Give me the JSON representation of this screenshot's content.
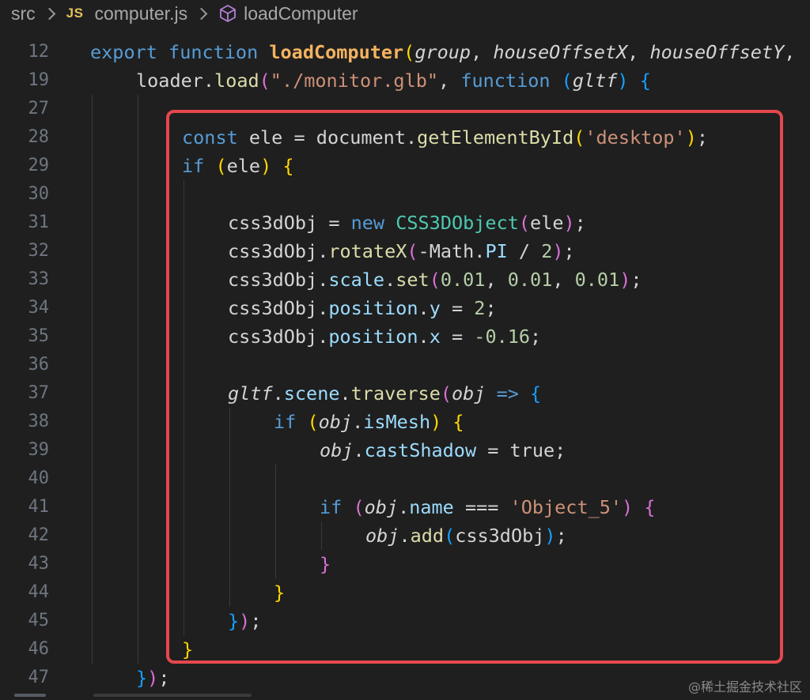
{
  "breadcrumb": {
    "folder": "src",
    "file_badge": "JS",
    "file": "computer.js",
    "symbol": "loadComputer"
  },
  "colors": {
    "keyword": "#569cd6",
    "control": "#c586c0",
    "function": "#dcdcaa",
    "funcdef": "#f4b35f",
    "variable": "#d4d4d4",
    "property": "#9cdcfe",
    "string": "#ce9178",
    "number": "#b5cea8",
    "class": "#4ec9b0",
    "bracket1": "#ffd700",
    "bracket2": "#da70d6",
    "bracket3": "#179fff",
    "highlight": "#e5484d"
  },
  "lines": [
    {
      "n": "12",
      "indent": 0,
      "tokens": [
        [
          "export ",
          "kw"
        ],
        [
          "function ",
          "kw"
        ],
        [
          "loadComputer",
          "fd"
        ],
        [
          "(",
          "b1"
        ],
        [
          "group",
          "pi"
        ],
        [
          ", ",
          "pl"
        ],
        [
          "houseOffsetX",
          "pi"
        ],
        [
          ", ",
          "pl"
        ],
        [
          "houseOffsetY",
          "pi"
        ],
        [
          ",",
          "pl"
        ]
      ]
    },
    {
      "n": "19",
      "indent": 1,
      "tokens": [
        [
          "loader",
          "pl"
        ],
        [
          ".",
          "pl"
        ],
        [
          "load",
          "fn"
        ],
        [
          "(",
          "b2"
        ],
        [
          "\"./monitor.glb\"",
          "st"
        ],
        [
          ", ",
          "pl"
        ],
        [
          "function ",
          "kw"
        ],
        [
          "(",
          "b3"
        ],
        [
          "gltf",
          "pi"
        ],
        [
          ") ",
          "b3"
        ],
        [
          "{",
          "b3"
        ]
      ]
    },
    {
      "n": "27",
      "indent": 0,
      "tokens": []
    },
    {
      "n": "28",
      "indent": 2,
      "tokens": [
        [
          "const ",
          "kw"
        ],
        [
          "ele",
          "pl"
        ],
        [
          " = ",
          "pl"
        ],
        [
          "document",
          "pl"
        ],
        [
          ".",
          "pl"
        ],
        [
          "getElementById",
          "fn"
        ],
        [
          "(",
          "b1"
        ],
        [
          "'desktop'",
          "st"
        ],
        [
          ")",
          "b1"
        ],
        [
          ";",
          "pl"
        ]
      ]
    },
    {
      "n": "29",
      "indent": 2,
      "tokens": [
        [
          "if ",
          "ctl"
        ],
        [
          "(",
          "b1"
        ],
        [
          "ele",
          "pl"
        ],
        [
          ") ",
          "b1"
        ],
        [
          "{",
          "b1"
        ]
      ]
    },
    {
      "n": "30",
      "indent": 0,
      "tokens": []
    },
    {
      "n": "31",
      "indent": 3,
      "tokens": [
        [
          "css3dObj",
          "pl"
        ],
        [
          " = ",
          "pl"
        ],
        [
          "new ",
          "kw"
        ],
        [
          "CSS3DObject",
          "cl"
        ],
        [
          "(",
          "b2"
        ],
        [
          "ele",
          "pl"
        ],
        [
          ")",
          "b2"
        ],
        [
          ";",
          "pl"
        ]
      ]
    },
    {
      "n": "32",
      "indent": 3,
      "tokens": [
        [
          "css3dObj",
          "pl"
        ],
        [
          ".",
          "pl"
        ],
        [
          "rotateX",
          "fn"
        ],
        [
          "(",
          "b2"
        ],
        [
          "-Math",
          "pl"
        ],
        [
          ".",
          "pl"
        ],
        [
          "PI",
          "cst"
        ],
        [
          " / ",
          "pl"
        ],
        [
          "2",
          "nm"
        ],
        [
          ")",
          "b2"
        ],
        [
          ";",
          "pl"
        ]
      ]
    },
    {
      "n": "33",
      "indent": 3,
      "tokens": [
        [
          "css3dObj",
          "pl"
        ],
        [
          ".",
          "pl"
        ],
        [
          "scale",
          "pr"
        ],
        [
          ".",
          "pl"
        ],
        [
          "set",
          "fn"
        ],
        [
          "(",
          "b2"
        ],
        [
          "0.01",
          "nm"
        ],
        [
          ", ",
          "pl"
        ],
        [
          "0.01",
          "nm"
        ],
        [
          ", ",
          "pl"
        ],
        [
          "0.01",
          "nm"
        ],
        [
          ")",
          "b2"
        ],
        [
          ";",
          "pl"
        ]
      ]
    },
    {
      "n": "34",
      "indent": 3,
      "tokens": [
        [
          "css3dObj",
          "pl"
        ],
        [
          ".",
          "pl"
        ],
        [
          "position",
          "pr"
        ],
        [
          ".",
          "pl"
        ],
        [
          "y",
          "pr"
        ],
        [
          " = ",
          "pl"
        ],
        [
          "2",
          "nm"
        ],
        [
          ";",
          "pl"
        ]
      ]
    },
    {
      "n": "35",
      "indent": 3,
      "tokens": [
        [
          "css3dObj",
          "pl"
        ],
        [
          ".",
          "pl"
        ],
        [
          "position",
          "pr"
        ],
        [
          ".",
          "pl"
        ],
        [
          "x",
          "pr"
        ],
        [
          " = ",
          "pl"
        ],
        [
          "-0.16",
          "nm"
        ],
        [
          ";",
          "pl"
        ]
      ]
    },
    {
      "n": "36",
      "indent": 0,
      "tokens": []
    },
    {
      "n": "37",
      "indent": 3,
      "tokens": [
        [
          "gltf",
          "pi"
        ],
        [
          ".",
          "pl"
        ],
        [
          "scene",
          "pr"
        ],
        [
          ".",
          "pl"
        ],
        [
          "traverse",
          "fn"
        ],
        [
          "(",
          "b2"
        ],
        [
          "obj",
          "pi"
        ],
        [
          " => ",
          "kw"
        ],
        [
          "{",
          "b3"
        ]
      ]
    },
    {
      "n": "38",
      "indent": 4,
      "tokens": [
        [
          "if ",
          "ctl"
        ],
        [
          "(",
          "b1"
        ],
        [
          "obj",
          "pi"
        ],
        [
          ".",
          "pl"
        ],
        [
          "isMesh",
          "pr"
        ],
        [
          ") ",
          "b1"
        ],
        [
          "{",
          "b1"
        ]
      ]
    },
    {
      "n": "39",
      "indent": 5,
      "tokens": [
        [
          "obj",
          "pi"
        ],
        [
          ".",
          "pl"
        ],
        [
          "castShadow",
          "pr"
        ],
        [
          " = ",
          "pl"
        ],
        [
          "true",
          "pl"
        ],
        [
          ";",
          "pl"
        ]
      ]
    },
    {
      "n": "40",
      "indent": 0,
      "tokens": []
    },
    {
      "n": "41",
      "indent": 5,
      "tokens": [
        [
          "if ",
          "ctl"
        ],
        [
          "(",
          "b2"
        ],
        [
          "obj",
          "pi"
        ],
        [
          ".",
          "pl"
        ],
        [
          "name",
          "pr"
        ],
        [
          " === ",
          "pl"
        ],
        [
          "'Object_5'",
          "st"
        ],
        [
          ") ",
          "b2"
        ],
        [
          "{",
          "b2"
        ]
      ]
    },
    {
      "n": "42",
      "indent": 6,
      "tokens": [
        [
          "obj",
          "pi"
        ],
        [
          ".",
          "pl"
        ],
        [
          "add",
          "fn"
        ],
        [
          "(",
          "b3"
        ],
        [
          "css3dObj",
          "pl"
        ],
        [
          ")",
          "b3"
        ],
        [
          ";",
          "pl"
        ]
      ]
    },
    {
      "n": "43",
      "indent": 5,
      "tokens": [
        [
          "}",
          "b2"
        ]
      ]
    },
    {
      "n": "44",
      "indent": 4,
      "tokens": [
        [
          "}",
          "b1"
        ]
      ]
    },
    {
      "n": "45",
      "indent": 3,
      "tokens": [
        [
          "}",
          "b3"
        ],
        [
          ")",
          "b2"
        ],
        [
          ";",
          "pl"
        ]
      ]
    },
    {
      "n": "46",
      "indent": 2,
      "tokens": [
        [
          "}",
          "b1"
        ]
      ]
    },
    {
      "n": "47",
      "indent": 1,
      "tokens": [
        [
          "}",
          "b3"
        ],
        [
          ")",
          "b2"
        ],
        [
          ";",
          "pl"
        ]
      ]
    }
  ],
  "watermark": "@稀土掘金技术社区"
}
